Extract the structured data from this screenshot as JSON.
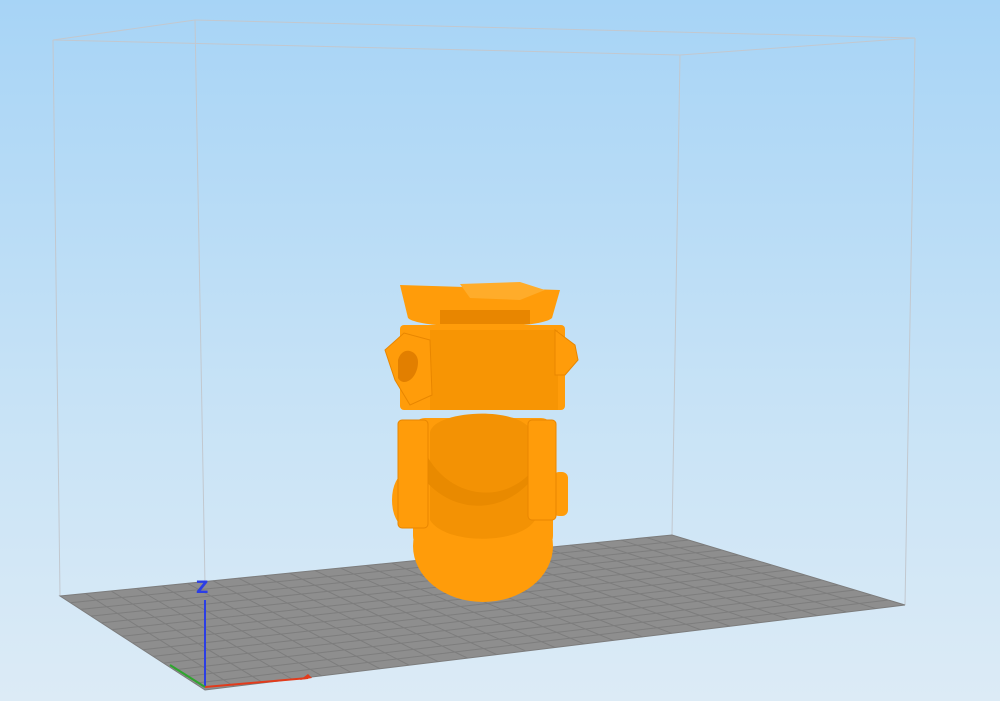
{
  "viewport": {
    "background_top": "#a7d4f6",
    "background_bottom": "#dcebf6"
  },
  "colors": {
    "model": "#ff9c0a",
    "model_shade": "#e27f00",
    "bed": "#8e8e8e",
    "bed_grid": "#7a7a7a",
    "volume_edge": "#c2c8cf",
    "axis_x": "#e23b1c",
    "axis_y": "#2ea52e",
    "axis_z": "#2b3ee6"
  },
  "axis": {
    "z_label": "Z"
  }
}
